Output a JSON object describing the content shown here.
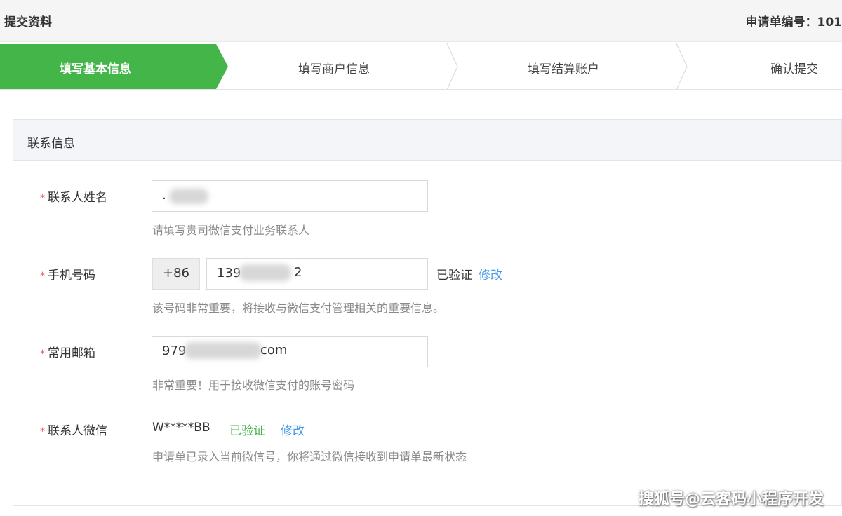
{
  "header": {
    "title": "提交资料",
    "order_number": "申请单编号：101"
  },
  "steps": [
    {
      "label": "填写基本信息",
      "active": true
    },
    {
      "label": "填写商户信息",
      "active": false
    },
    {
      "label": "填写结算账户",
      "active": false
    },
    {
      "label": "确认提交",
      "active": false
    }
  ],
  "section": {
    "title": "联系信息"
  },
  "fields": {
    "name": {
      "required_mark": "*",
      "label": "联系人姓名",
      "value": ".",
      "hint": "请填写贵司微信支付业务联系人"
    },
    "phone": {
      "required_mark": "*",
      "label": "手机号码",
      "prefix": "+86",
      "value_start": "139",
      "value_end": "2",
      "status": "已验证",
      "edit": "修改",
      "hint": "该号码非常重要，将接收与微信支付管理相关的重要信息。"
    },
    "email": {
      "required_mark": "*",
      "label": "常用邮箱",
      "value_start": "979",
      "value_end": "com",
      "hint": "非常重要！用于接收微信支付的账号密码"
    },
    "wechat": {
      "required_mark": "*",
      "label": "联系人微信",
      "value": "W*****BB",
      "status": "已验证",
      "edit": "修改",
      "hint": "申请单已录入当前微信号，你将通过微信接收到申请单最新状态"
    }
  },
  "watermark": "搜狐号@云客码小程序开发",
  "colors": {
    "accent_green": "#44b549",
    "link_blue": "#459ae9",
    "required_red": "#e15f63"
  }
}
